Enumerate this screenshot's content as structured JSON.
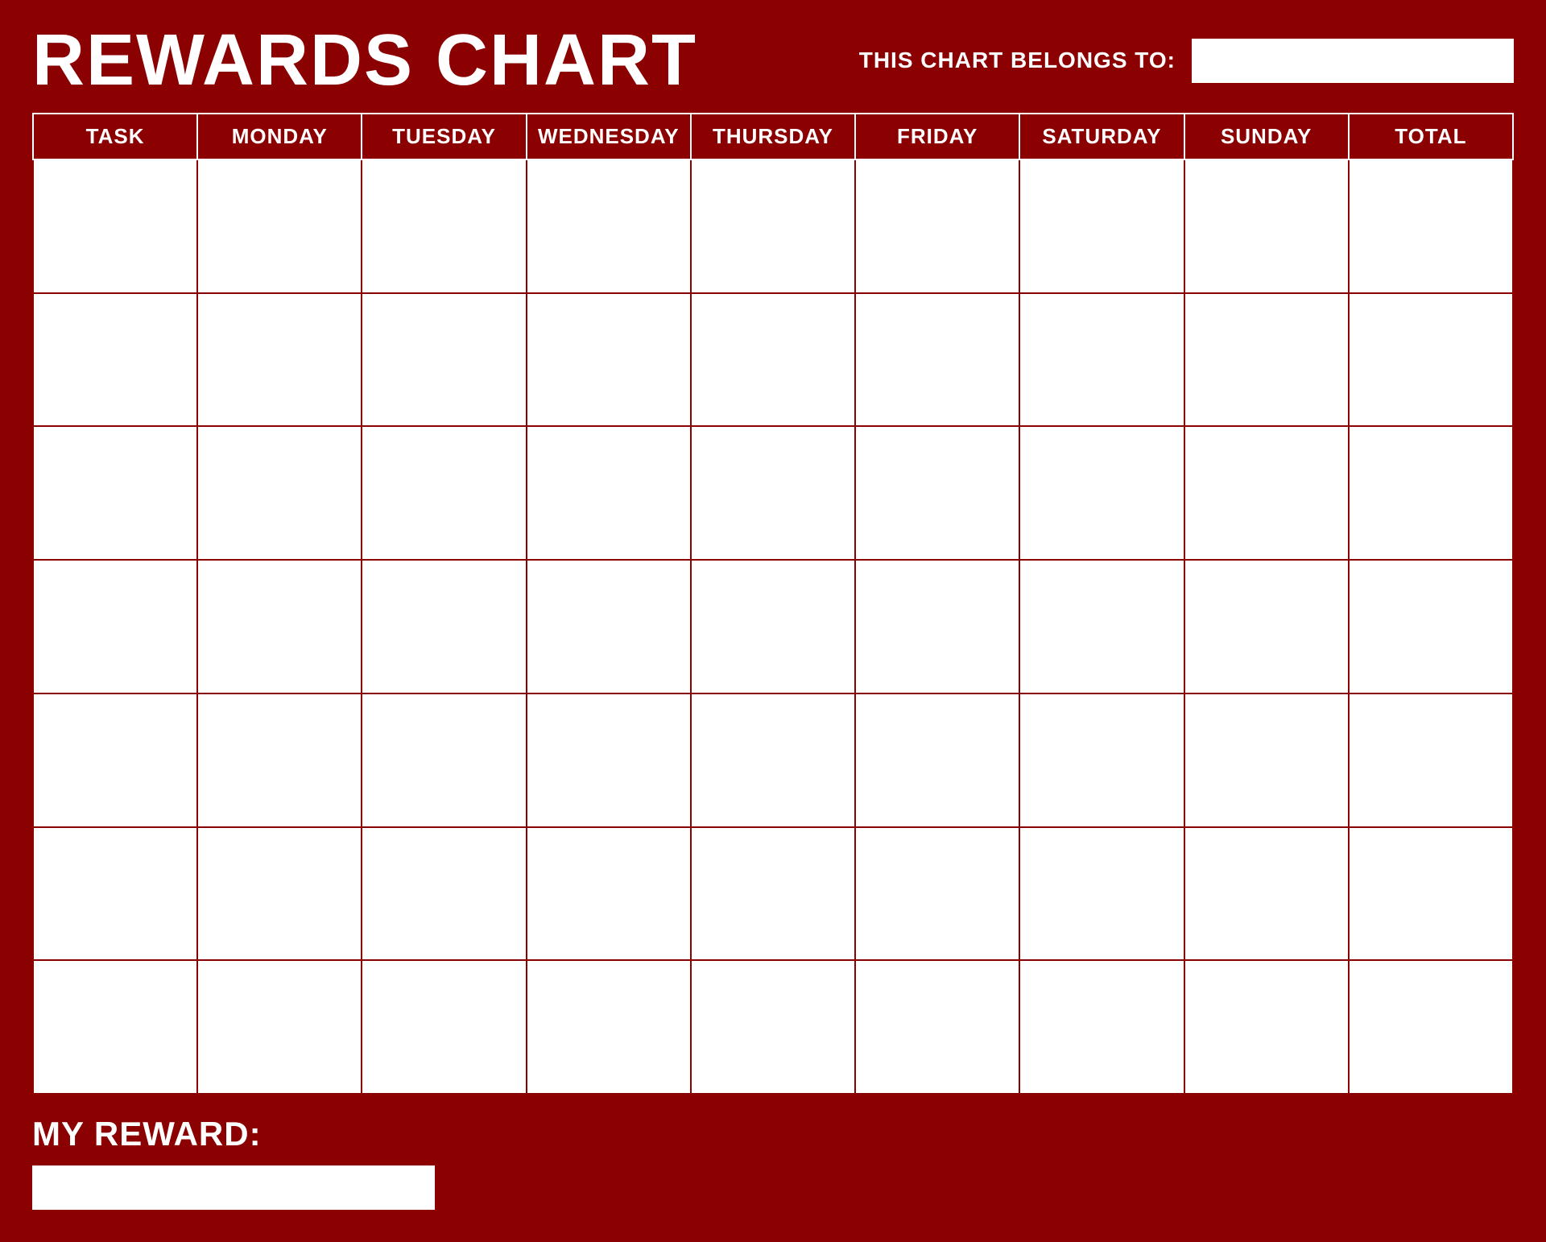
{
  "header": {
    "title": "REWARDS CHART",
    "belongs_to_label": "THIS CHART BELONGS TO:",
    "name_placeholder": ""
  },
  "table": {
    "columns": [
      {
        "id": "task",
        "label": "TASK"
      },
      {
        "id": "monday",
        "label": "MONDAY"
      },
      {
        "id": "tuesday",
        "label": "TUESDAY"
      },
      {
        "id": "wednesday",
        "label": "WEDNESDAY"
      },
      {
        "id": "thursday",
        "label": "THURSDAY"
      },
      {
        "id": "friday",
        "label": "FRIDAY"
      },
      {
        "id": "saturday",
        "label": "SATURDAY"
      },
      {
        "id": "sunday",
        "label": "SUNDAY"
      },
      {
        "id": "total",
        "label": "tOTAL"
      }
    ],
    "row_count": 7
  },
  "footer": {
    "reward_label": "MY REWARD:",
    "reward_placeholder": ""
  },
  "colors": {
    "background": "#8B0000",
    "text_white": "#ffffff",
    "cell_bg": "#ffffff",
    "border": "#8B0000"
  }
}
